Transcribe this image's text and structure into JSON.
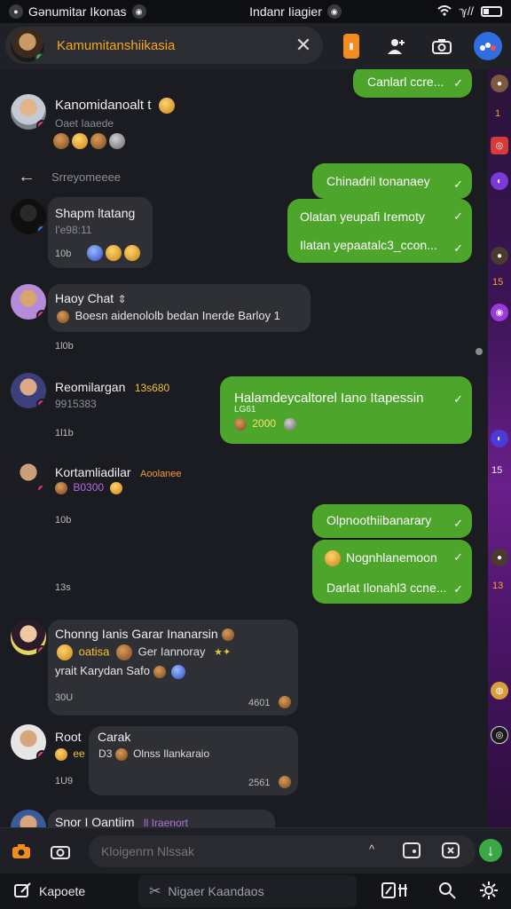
{
  "status_bar": {
    "left_text": "Gənumitar Ikonas",
    "center_text": "Indanr Iiagier",
    "icons": [
      "wifi-icon",
      "signal-icon",
      "battery-icon"
    ]
  },
  "header": {
    "title": "Kamumitanshiikasia",
    "close_glyph": "✕"
  },
  "messages": [
    {
      "id": "m1",
      "name": "Kanomidanoalt t",
      "subtitle": "Oaet Iaaede"
    },
    {
      "id": "out1",
      "text": "Canlarl ccre..."
    },
    {
      "id": "divider",
      "label": "Srreyomeeee"
    },
    {
      "id": "m2",
      "name": "Shapm ltatang",
      "subtitle": "I'e98:11",
      "time": "10b"
    },
    {
      "id": "out2",
      "text": "Chinadril tonanaey"
    },
    {
      "id": "out3",
      "text": "Olatan yeupafi Iremoty"
    },
    {
      "id": "out4",
      "text": "Ilatan yepaatalc3_ccon..."
    },
    {
      "id": "m3",
      "name": "Haoy Chat",
      "text": "Boesn aidenololb bedan Inerde Barloy 1",
      "time": "1l0b"
    },
    {
      "id": "m4",
      "name": "Reomilargan",
      "extra": "13s680",
      "subtitle": "9915383",
      "time": "1l1b"
    },
    {
      "id": "out5",
      "text": "Halamdeycaltorel Iano Itapessin",
      "sub": "LG61",
      "sub2": "2000"
    },
    {
      "id": "m5",
      "name": "Kortamliadilar",
      "extra": "Aoolanee",
      "subtitle": "B0300",
      "time": "10b"
    },
    {
      "id": "out6",
      "text": "Olpnoothiibanarary"
    },
    {
      "id": "out7",
      "text": "Nognhlanemoon"
    },
    {
      "id": "out8",
      "text": "Darlat Ilonahl3 ccne..."
    },
    {
      "id": "m6_time",
      "time": "13s"
    },
    {
      "id": "m6",
      "name": "Chonng Ianis Garar Inanarsin",
      "line2": "oatisa",
      "line2b": "Ger Iannoray",
      "line3": "yrait Karydan Safo",
      "time_l": "30U",
      "time_r": "4601"
    },
    {
      "id": "m7",
      "name": "Root",
      "name2": "Carak",
      "line2": "ee",
      "line2b": "D3",
      "line2c": "Olnss Ilankaraio",
      "time_l": "1U9",
      "time_r": "2561"
    },
    {
      "id": "m8",
      "name": "Snor I Oantiim",
      "extra": "ll Iraenort"
    }
  ],
  "edge_labels": {
    "a": "1",
    "b": "15",
    "c": "15",
    "d": "13"
  },
  "input_bar": {
    "placeholder": "Kloigenrn Nlssak",
    "caret": "^"
  },
  "bottom_nav": {
    "left_label": "Kapoete",
    "center_label": "Nigaer Kaandaos"
  },
  "colors": {
    "accent_green": "#4ea52b",
    "header_title": "#f5a623",
    "bg": "#1b1c21",
    "edge_purple": "#6a1f8a"
  }
}
